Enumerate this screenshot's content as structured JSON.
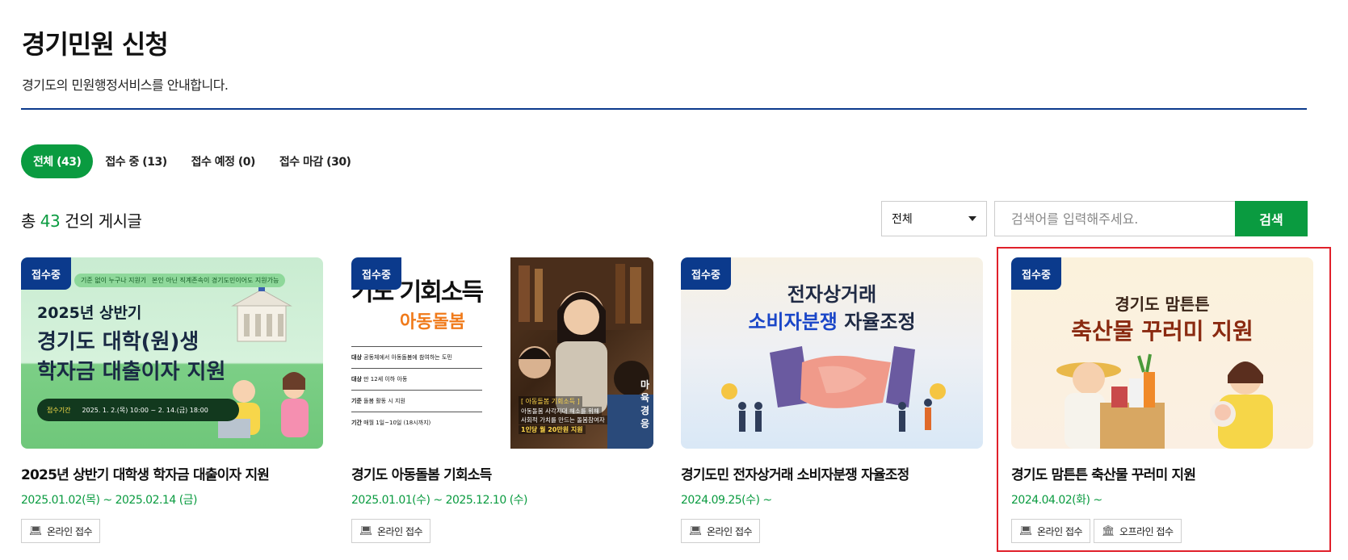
{
  "header": {
    "title": "경기민원 신청",
    "description": "경기도의 민원행정서비스를 안내합니다."
  },
  "tabs": [
    {
      "label": "전체 (43)",
      "active": true
    },
    {
      "label": "접수 중 (13)",
      "active": false
    },
    {
      "label": "접수 예정 (0)",
      "active": false
    },
    {
      "label": "접수 마감 (30)",
      "active": false
    }
  ],
  "summary": {
    "prefix": "총 ",
    "count": "43",
    "suffix": " 건의 게시글"
  },
  "search": {
    "select_value": "전체",
    "placeholder": "검색어를 입력해주세요.",
    "button_label": "검색"
  },
  "cards": [
    {
      "badge": "접수중",
      "title": "2025년 상반기 대학생 학자금 대출이자 지원",
      "date": "2025.01.02(목) ~ 2025.02.14 (금)",
      "buttons": [
        "온라인 접수"
      ],
      "thumb": {
        "chip1": "기준 없이 누구나 지원가능",
        "chip2": "본인 아닌 직계존속이 경기도민이어도 지원가능",
        "line1": "2025년 상반기",
        "line2": "경기도 대학(원)생",
        "line3": "학자금 대출이자 지원",
        "period_label": "접수기간",
        "period": "2025. 1. 2.(목) 10:00 ~ 2. 14.(금) 18:00"
      }
    },
    {
      "badge": "접수중",
      "title": "경기도 아동돌봄 기회소득",
      "date": "2025.01.01(수) ~ 2025.12.10 (수)",
      "buttons": [
        "온라인 접수"
      ],
      "thumb": {
        "line1": "기도 기회소득",
        "line2": "아동돌봄",
        "rows": [
          {
            "k": "대상",
            "v": "공동체에서 아동돌봄에 참여하는 도민"
          },
          {
            "k": "대상",
            "v": "만 12세 이하 아동"
          },
          {
            "k": "기준",
            "v": "돌봄 활동 시 지원"
          },
          {
            "k": "기간",
            "v": "매월 1일~10일 (18시까지)"
          }
        ],
        "photo_tag": "[ 아동돌봄 기회소득 ]",
        "photo_l1": "아동돌봄 사각지대 해소를 위해",
        "photo_l2": "사회적 가치를 만드는 돌봄참여자",
        "photo_l3": "1인당 월 20만원 지원",
        "side_text": "마육경응"
      }
    },
    {
      "badge": "접수중",
      "title": "경기도민 전자상거래 소비자분쟁 자율조정",
      "date": "2024.09.25(수) ~",
      "buttons": [
        "온라인 접수"
      ],
      "thumb": {
        "line1": "전자상거래",
        "line2a": "소비자분쟁",
        "line2b": " 자율조정"
      }
    },
    {
      "badge": "접수중",
      "title": "경기도 맘튼튼 축산물 꾸러미 지원",
      "date": "2024.04.02(화) ~",
      "buttons": [
        "온라인 접수",
        "오프라인 접수"
      ],
      "thumb": {
        "line1": "경기도 맘튼튼",
        "line2": "축산물 꾸러미 지원"
      }
    }
  ],
  "colors": {
    "brand_green": "#0a9b40",
    "brand_navy": "#0b3a8c",
    "highlight_red": "#e0202a"
  }
}
